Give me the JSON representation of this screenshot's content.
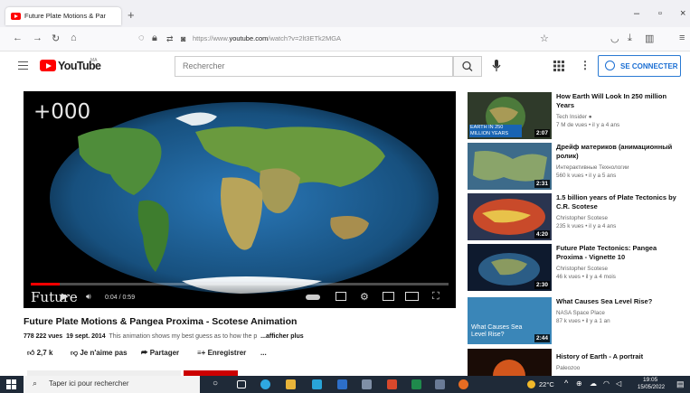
{
  "browser": {
    "tab_title": "Future Plate Motions & Pangea ×",
    "tab_close": "×",
    "new_tab": "+",
    "url_prefix": "https://www.",
    "url_domain": "youtube.com",
    "url_rest": "/watch?v=2lt3ETk2MGA",
    "win_minimize": "–",
    "win_restore": "▫",
    "win_close": "×"
  },
  "youtube": {
    "logo_text": "YouTube",
    "logo_sup": "MA",
    "search_placeholder": "Rechercher",
    "connect_label": "SE CONNECTER"
  },
  "player": {
    "overlay_timer": "+000",
    "watermark": "Future",
    "time": "0:04 / 0:59",
    "progress": 0.07
  },
  "video": {
    "title": "Future Plate Motions & Pangea Proxima - Scotese Animation",
    "views": "778 222 vues",
    "date": "19 sept. 2014",
    "description": "This animation shows my best guess as to how the p",
    "show_more": "...afficher plus",
    "likes": "2,7 k",
    "dislike": "Je n'aime pas",
    "share": "Partager",
    "save": "Enregistrer",
    "more": "..."
  },
  "sidebar": [
    {
      "title": "How Earth Will Look In 250 million Years",
      "channel": "Tech Insider",
      "stats": "7 M de vues • il y a 4 ans",
      "duration": "2:07",
      "thumb_text": "EARTH IN 250 MILLION YEARS"
    },
    {
      "title": "Дрейф материков (анимационный ролик)",
      "channel": "Интерактивные Технологии",
      "stats": "560 k vues • il y a 5 ans",
      "duration": "2:31",
      "thumb_text": ""
    },
    {
      "title": "1.5 billion years of Plate Tectonics by C.R. Scotese",
      "channel": "Christopher Scotese",
      "stats": "235 k vues • il y a 4 ans",
      "duration": "4:20",
      "thumb_text": ""
    },
    {
      "title": "Future Plate Tectonics: Pangea Proxima - Vignette 10",
      "channel": "Christopher Scotese",
      "stats": "46 k vues • il y a 4 mois",
      "duration": "2:30",
      "thumb_text": ""
    },
    {
      "title": "What Causes Sea Level Rise?",
      "channel": "NASA Space Place",
      "stats": "87 k vues • il y a 1 an",
      "duration": "2:44",
      "thumb_text": "What Causes Sea Level Rise?"
    },
    {
      "title": "History of Earth - A portrait",
      "channel": "Paleozoo",
      "stats": "",
      "duration": "",
      "thumb_text": ""
    }
  ],
  "taskbar": {
    "search_placeholder": "Taper ici pour rechercher",
    "weather": "22°C",
    "time": "19:05",
    "date": "15/05/2022"
  },
  "colors": {
    "brand_red": "#ff0000",
    "link_blue": "#1a6ed3",
    "taskbar": "#1f2a38"
  }
}
